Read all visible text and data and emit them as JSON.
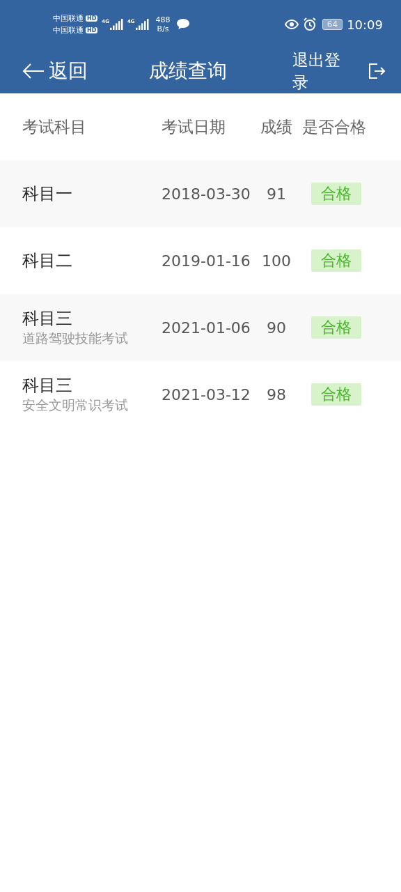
{
  "status_bar": {
    "carriers": [
      {
        "name": "中国联通",
        "badge": "HD",
        "network": "4G"
      },
      {
        "name": "中国联通",
        "badge": "HD",
        "network": "4G"
      }
    ],
    "speed_value": "488",
    "speed_unit": "B/s",
    "battery": "64",
    "time": "10:09"
  },
  "header": {
    "back": "返回",
    "title": "成绩查询",
    "logout": "退出登录"
  },
  "table": {
    "columns": [
      "考试科目",
      "考试日期",
      "成绩",
      "是否合格"
    ],
    "rows": [
      {
        "subject": "科目一",
        "date": "2018-03-30",
        "score": "91",
        "result": "合格",
        "passed": true
      },
      {
        "subject": "科目二",
        "date": "2019-01-16",
        "score": "100",
        "result": "合格",
        "passed": true
      },
      {
        "subject": "科目三",
        "detail": "道路驾驶技能考试",
        "date": "2021-01-06",
        "score": "90",
        "result": "合格",
        "passed": true
      },
      {
        "subject": "科目三",
        "detail": "安全文明常识考试",
        "date": "2021-03-12",
        "score": "98",
        "result": "合格",
        "passed": true
      }
    ]
  }
}
